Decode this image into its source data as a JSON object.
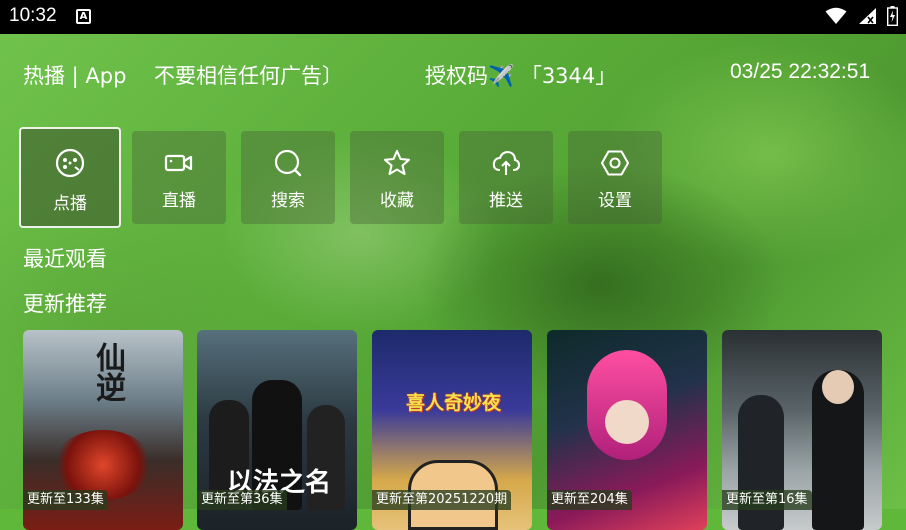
{
  "status": {
    "time": "10:32",
    "notif_letter": "A"
  },
  "header": {
    "app": "热播 | App",
    "tip": "不要相信任何广告〕",
    "auth": "授权码✈️ 「3344」",
    "datetime": "03/25 22:32:51"
  },
  "menu": [
    {
      "label": "点播",
      "icon": "film-reel-icon",
      "active": true
    },
    {
      "label": "直播",
      "icon": "video-camera-icon"
    },
    {
      "label": "搜索",
      "icon": "search-icon"
    },
    {
      "label": "收藏",
      "icon": "star-icon"
    },
    {
      "label": "推送",
      "icon": "cloud-upload-icon"
    },
    {
      "label": "设置",
      "icon": "settings-hexagon-icon"
    }
  ],
  "sections": {
    "recent": "最近观看",
    "updates": "更新推荐"
  },
  "cards": [
    {
      "badge": "更新至133集",
      "title": "仙逆"
    },
    {
      "badge": "更新至第36集",
      "title": "以法之名"
    },
    {
      "badge": "更新至第20251220期",
      "title": "喜人奇妙夜"
    },
    {
      "badge": "更新至204集",
      "title": ""
    },
    {
      "badge": "更新至第16集",
      "title": ""
    }
  ],
  "colors": {
    "accent": "#5fb83a",
    "statusbar": "#000000"
  }
}
